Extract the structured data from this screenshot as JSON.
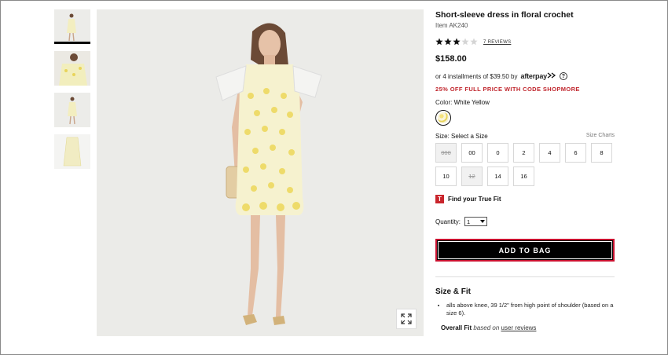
{
  "product": {
    "title": "Short-sleeve dress in floral crochet",
    "item_number": "Item AK240",
    "rating": {
      "value": 3,
      "max": 5,
      "reviews_label": "7 REVIEWS"
    },
    "price": "$158.00",
    "installments_text": "or 4 installments of $39.50 by",
    "afterpay_label": "afterpay",
    "promo": "25% OFF FULL PRICE WITH CODE SHOPMORE",
    "color": {
      "label": "Color:",
      "value": "White Yellow"
    },
    "size": {
      "label": "Size:",
      "value": "Select a Size",
      "charts_label": "Size Charts",
      "options": [
        {
          "label": "000",
          "available": false
        },
        {
          "label": "00",
          "available": true
        },
        {
          "label": "0",
          "available": true
        },
        {
          "label": "2",
          "available": true
        },
        {
          "label": "4",
          "available": true
        },
        {
          "label": "6",
          "available": true
        },
        {
          "label": "8",
          "available": true
        },
        {
          "label": "10",
          "available": true
        },
        {
          "label": "12",
          "available": false
        },
        {
          "label": "14",
          "available": true
        },
        {
          "label": "16",
          "available": true
        }
      ]
    },
    "truefit": {
      "logo": "T",
      "label": "Find your True Fit"
    },
    "quantity": {
      "label": "Quantity:",
      "value": "1"
    },
    "add_to_bag": "ADD TO BAG",
    "size_fit": {
      "title": "Size & Fit",
      "bullets": [
        "alls above knee, 39 1/2\" from high point of shoulder (based on a size 6)."
      ],
      "overall_fit": "Overall Fit",
      "based_on": "based on",
      "user_reviews": "user reviews"
    }
  },
  "icons": {
    "expand": "expand-icon",
    "help": "help-icon",
    "star": "star-icon"
  },
  "colors": {
    "promo": "#c0262d",
    "accent_border": "#c8102e",
    "button_bg": "#000000"
  }
}
